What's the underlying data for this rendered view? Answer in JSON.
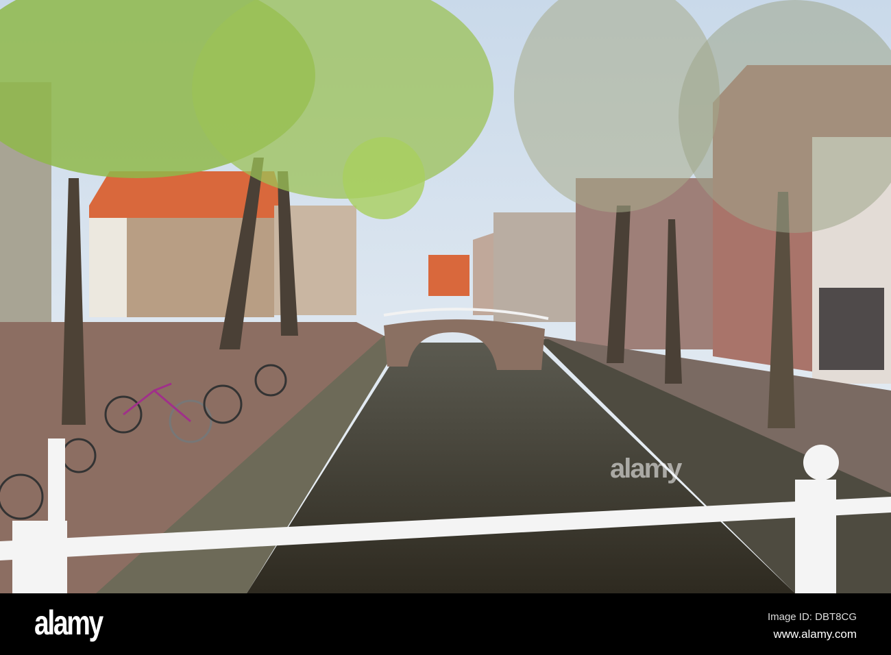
{
  "watermark": {
    "logo": "alamy",
    "image_id": "Image ID: DBT8CG",
    "url": "www.alamy.com"
  },
  "colors": {
    "sky": "#dfe8f0",
    "water": "#3f3a2c",
    "foliage": "#8fb84a",
    "railing": "#f4f4f4",
    "roof": "#d9683c"
  }
}
